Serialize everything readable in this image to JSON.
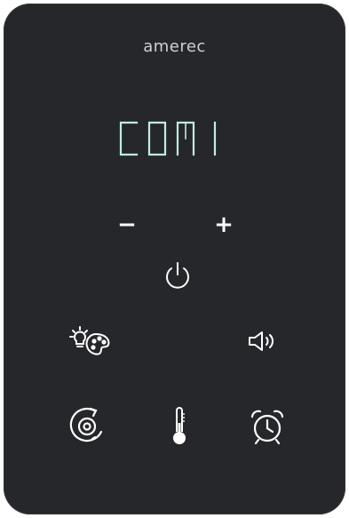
{
  "brand": {
    "name": "amerec"
  },
  "display": {
    "text": "CON1",
    "color": "#bdeee6"
  },
  "controls": {
    "minus_label": "−",
    "plus_label": "+"
  },
  "icons": {
    "power": "power-icon",
    "light": "light-color-palette-icon",
    "sound": "speaker-sound-icon",
    "cycle": "steam-cycle-icon",
    "temperature": "thermometer-icon",
    "timer": "alarm-clock-icon"
  },
  "colors": {
    "panel": "#26272a",
    "icon": "#ffffff",
    "brand_text": "#cfd0d2"
  }
}
